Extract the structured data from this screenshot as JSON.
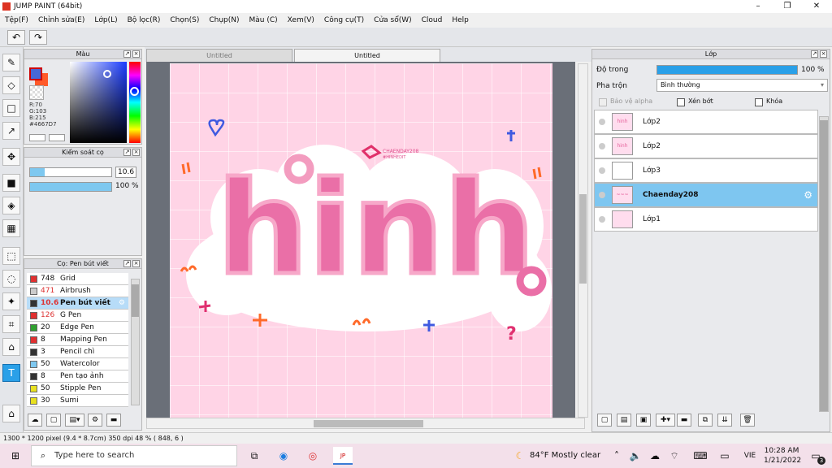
{
  "window": {
    "title": "JUMP PAINT (64bit)",
    "minimize": "–",
    "maximize": "❐",
    "close": "✕"
  },
  "menu": [
    "Tệp(F)",
    "Chỉnh sửa(E)",
    "Lớp(L)",
    "Bộ lọc(R)",
    "Chọn(S)",
    "Chụp(N)",
    "Màu (C)",
    "Xem(V)",
    "Công cụ(T)",
    "Cửa sổ(W)",
    "Cloud",
    "Help"
  ],
  "undo_icon": "↶",
  "redo_icon": "↷",
  "tools": [
    "✎",
    "◇",
    "□",
    "↗",
    "✥",
    "■",
    "◈",
    "▦",
    "⬚",
    "◌",
    "✦",
    "⌗",
    "⌂",
    "T",
    "⌂"
  ],
  "color_panel": {
    "title": "Màu",
    "fg": "#4667D7",
    "bg": "#ff5a2a",
    "r": "R:70",
    "g": "G:103",
    "b": "B:215",
    "hex": "#4667D7"
  },
  "brush_control": {
    "title": "Kiểm soát cọ",
    "size": "10.6",
    "size_fraction": 0.18,
    "opacity": "100 %",
    "opacity_fraction": 1.0
  },
  "brush_panel": {
    "title": "Cọ: Pen bút viết",
    "items": [
      {
        "size": "748",
        "name": "Grid",
        "color": "#e03030",
        "size_color": "#111"
      },
      {
        "size": "471",
        "name": "Airbrush",
        "color": "#cccccc",
        "size_color": "#d33"
      },
      {
        "size": "10.6",
        "name": "Pen bút viết",
        "color": "#333333",
        "size_color": "#d33"
      },
      {
        "size": "126",
        "name": "G Pen",
        "color": "#e03030",
        "size_color": "#d33"
      },
      {
        "size": "20",
        "name": "Edge Pen",
        "color": "#30a030",
        "size_color": "#111"
      },
      {
        "size": "8",
        "name": "Mapping Pen",
        "color": "#e03030",
        "size_color": "#111"
      },
      {
        "size": "3",
        "name": "Pencil chì",
        "color": "#333333",
        "size_color": "#111"
      },
      {
        "size": "50",
        "name": "Watercolor",
        "color": "#7ec8f0",
        "size_color": "#111"
      },
      {
        "size": "8",
        "name": "Pen tạo ảnh",
        "color": "#333333",
        "size_color": "#111"
      },
      {
        "size": "50",
        "name": "Stipple Pen",
        "color": "#e8e020",
        "size_color": "#111"
      },
      {
        "size": "30",
        "name": "Sumi",
        "color": "#e8e020",
        "size_color": "#111"
      }
    ]
  },
  "tabs": [
    "Untitled",
    "Untitled"
  ],
  "artwork": {
    "word": "hinh",
    "tag": "CHAENDAY208",
    "tag2": "#HINHEDIT"
  },
  "layer_panel": {
    "title": "Lớp",
    "opacity_label": "Độ trong",
    "opacity_value": "100 %",
    "opacity_fraction": 1.0,
    "blend_label": "Pha trộn",
    "blend_value": "Bình thường",
    "protect_alpha": "Bảo vệ alpha",
    "clipping": "Xén bớt",
    "lock": "Khóa",
    "layers": [
      {
        "name": "Lớp2",
        "thumb": "hinh"
      },
      {
        "name": "Lớp2",
        "thumb": "hinh"
      },
      {
        "name": "Lớp3",
        "thumb": ""
      },
      {
        "name": "Chaenday208",
        "thumb": "~~~"
      },
      {
        "name": "Lớp1",
        "thumb": ""
      }
    ]
  },
  "status": "1300 * 1200 pixel   (9.4 * 8.7cm)   350 dpi   48 %   ( 848, 6 )",
  "taskbar": {
    "search_placeholder": "Type here to search",
    "weather": "84°F  Mostly clear",
    "lang": "VIE",
    "time": "10:28 AM",
    "date": "1/21/2022",
    "notif": "3"
  }
}
